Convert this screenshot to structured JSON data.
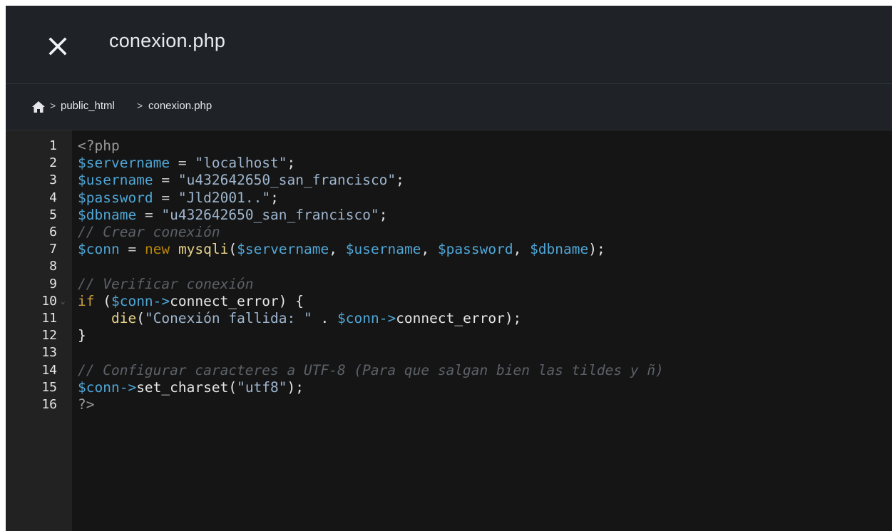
{
  "header": {
    "title": "conexion.php",
    "close_icon": "close-icon"
  },
  "breadcrumb": {
    "home_icon": "home-icon",
    "separator": ">",
    "items": [
      "public_html",
      "conexion.php"
    ]
  },
  "editor": {
    "lines": [
      {
        "n": "1",
        "code": "<?php"
      },
      {
        "n": "2",
        "code": "$servername = \"localhost\";"
      },
      {
        "n": "3",
        "code": "$username = \"u432642650_san_francisco\";"
      },
      {
        "n": "4",
        "code": "$password = \"Jld2001..\";"
      },
      {
        "n": "5",
        "code": "$dbname = \"u432642650_san_francisco\";"
      },
      {
        "n": "6",
        "code": "// Crear conexión"
      },
      {
        "n": "7",
        "code": "$conn = new mysqli($servername, $username, $password, $dbname);"
      },
      {
        "n": "8",
        "code": ""
      },
      {
        "n": "9",
        "code": "// Verificar conexión"
      },
      {
        "n": "10",
        "code": "if ($conn->connect_error) {"
      },
      {
        "n": "11",
        "code": "    die(\"Conexión fallida: \" . $conn->connect_error);"
      },
      {
        "n": "12",
        "code": "}"
      },
      {
        "n": "13",
        "code": ""
      },
      {
        "n": "14",
        "code": "// Configurar caracteres a UTF-8 (Para que salgan bien las tildes y ñ)"
      },
      {
        "n": "15",
        "code": "$conn->set_charset(\"utf8\");"
      },
      {
        "n": "16",
        "code": "?>"
      }
    ],
    "fold_marker_line": "10"
  },
  "colors": {
    "background": "#151515",
    "gutter": "#222222",
    "header": "#1f2327",
    "variable": "#4fa6d6",
    "string": "#9eb6cf",
    "keyword": "#b8860b",
    "comment": "#5c6168"
  }
}
